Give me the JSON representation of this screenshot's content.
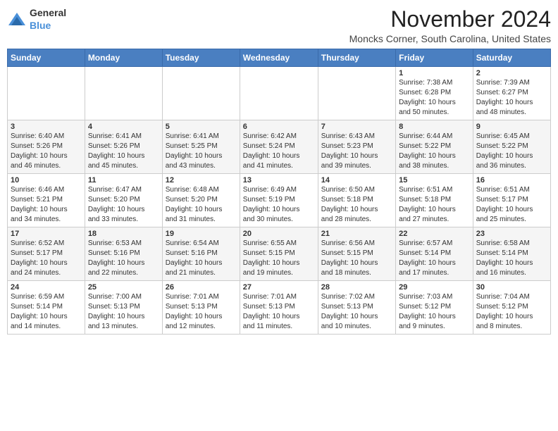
{
  "logo": {
    "general": "General",
    "blue": "Blue"
  },
  "header": {
    "month": "November 2024",
    "location": "Moncks Corner, South Carolina, United States"
  },
  "weekdays": [
    "Sunday",
    "Monday",
    "Tuesday",
    "Wednesday",
    "Thursday",
    "Friday",
    "Saturday"
  ],
  "weeks": [
    [
      {
        "day": "",
        "info": ""
      },
      {
        "day": "",
        "info": ""
      },
      {
        "day": "",
        "info": ""
      },
      {
        "day": "",
        "info": ""
      },
      {
        "day": "",
        "info": ""
      },
      {
        "day": "1",
        "info": "Sunrise: 7:38 AM\nSunset: 6:28 PM\nDaylight: 10 hours\nand 50 minutes."
      },
      {
        "day": "2",
        "info": "Sunrise: 7:39 AM\nSunset: 6:27 PM\nDaylight: 10 hours\nand 48 minutes."
      }
    ],
    [
      {
        "day": "3",
        "info": "Sunrise: 6:40 AM\nSunset: 5:26 PM\nDaylight: 10 hours\nand 46 minutes."
      },
      {
        "day": "4",
        "info": "Sunrise: 6:41 AM\nSunset: 5:26 PM\nDaylight: 10 hours\nand 45 minutes."
      },
      {
        "day": "5",
        "info": "Sunrise: 6:41 AM\nSunset: 5:25 PM\nDaylight: 10 hours\nand 43 minutes."
      },
      {
        "day": "6",
        "info": "Sunrise: 6:42 AM\nSunset: 5:24 PM\nDaylight: 10 hours\nand 41 minutes."
      },
      {
        "day": "7",
        "info": "Sunrise: 6:43 AM\nSunset: 5:23 PM\nDaylight: 10 hours\nand 39 minutes."
      },
      {
        "day": "8",
        "info": "Sunrise: 6:44 AM\nSunset: 5:22 PM\nDaylight: 10 hours\nand 38 minutes."
      },
      {
        "day": "9",
        "info": "Sunrise: 6:45 AM\nSunset: 5:22 PM\nDaylight: 10 hours\nand 36 minutes."
      }
    ],
    [
      {
        "day": "10",
        "info": "Sunrise: 6:46 AM\nSunset: 5:21 PM\nDaylight: 10 hours\nand 34 minutes."
      },
      {
        "day": "11",
        "info": "Sunrise: 6:47 AM\nSunset: 5:20 PM\nDaylight: 10 hours\nand 33 minutes."
      },
      {
        "day": "12",
        "info": "Sunrise: 6:48 AM\nSunset: 5:20 PM\nDaylight: 10 hours\nand 31 minutes."
      },
      {
        "day": "13",
        "info": "Sunrise: 6:49 AM\nSunset: 5:19 PM\nDaylight: 10 hours\nand 30 minutes."
      },
      {
        "day": "14",
        "info": "Sunrise: 6:50 AM\nSunset: 5:18 PM\nDaylight: 10 hours\nand 28 minutes."
      },
      {
        "day": "15",
        "info": "Sunrise: 6:51 AM\nSunset: 5:18 PM\nDaylight: 10 hours\nand 27 minutes."
      },
      {
        "day": "16",
        "info": "Sunrise: 6:51 AM\nSunset: 5:17 PM\nDaylight: 10 hours\nand 25 minutes."
      }
    ],
    [
      {
        "day": "17",
        "info": "Sunrise: 6:52 AM\nSunset: 5:17 PM\nDaylight: 10 hours\nand 24 minutes."
      },
      {
        "day": "18",
        "info": "Sunrise: 6:53 AM\nSunset: 5:16 PM\nDaylight: 10 hours\nand 22 minutes."
      },
      {
        "day": "19",
        "info": "Sunrise: 6:54 AM\nSunset: 5:16 PM\nDaylight: 10 hours\nand 21 minutes."
      },
      {
        "day": "20",
        "info": "Sunrise: 6:55 AM\nSunset: 5:15 PM\nDaylight: 10 hours\nand 19 minutes."
      },
      {
        "day": "21",
        "info": "Sunrise: 6:56 AM\nSunset: 5:15 PM\nDaylight: 10 hours\nand 18 minutes."
      },
      {
        "day": "22",
        "info": "Sunrise: 6:57 AM\nSunset: 5:14 PM\nDaylight: 10 hours\nand 17 minutes."
      },
      {
        "day": "23",
        "info": "Sunrise: 6:58 AM\nSunset: 5:14 PM\nDaylight: 10 hours\nand 16 minutes."
      }
    ],
    [
      {
        "day": "24",
        "info": "Sunrise: 6:59 AM\nSunset: 5:14 PM\nDaylight: 10 hours\nand 14 minutes."
      },
      {
        "day": "25",
        "info": "Sunrise: 7:00 AM\nSunset: 5:13 PM\nDaylight: 10 hours\nand 13 minutes."
      },
      {
        "day": "26",
        "info": "Sunrise: 7:01 AM\nSunset: 5:13 PM\nDaylight: 10 hours\nand 12 minutes."
      },
      {
        "day": "27",
        "info": "Sunrise: 7:01 AM\nSunset: 5:13 PM\nDaylight: 10 hours\nand 11 minutes."
      },
      {
        "day": "28",
        "info": "Sunrise: 7:02 AM\nSunset: 5:13 PM\nDaylight: 10 hours\nand 10 minutes."
      },
      {
        "day": "29",
        "info": "Sunrise: 7:03 AM\nSunset: 5:12 PM\nDaylight: 10 hours\nand 9 minutes."
      },
      {
        "day": "30",
        "info": "Sunrise: 7:04 AM\nSunset: 5:12 PM\nDaylight: 10 hours\nand 8 minutes."
      }
    ]
  ]
}
